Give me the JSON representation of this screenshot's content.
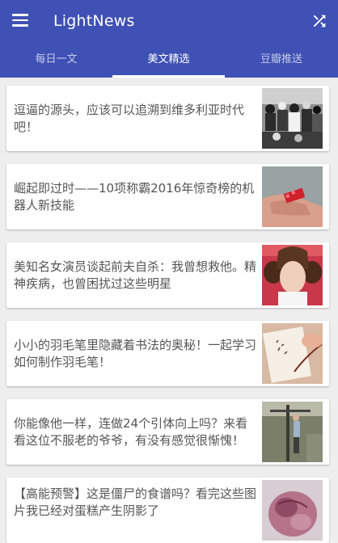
{
  "app": {
    "title": "LightNews"
  },
  "icons": {
    "menu": "menu-icon",
    "shuffle": "shuffle-icon"
  },
  "colors": {
    "primary": "#3f51b5",
    "tab_active": "#ffffff",
    "tab_inactive": "#c5cae9",
    "background": "#eeeeee"
  },
  "tabs": [
    {
      "label": "每日一文"
    },
    {
      "label": "美文精选",
      "active": true
    },
    {
      "label": "豆瓣推送"
    }
  ],
  "articles": [
    {
      "title": "逗逼的源头，应该可以追溯到维多利亚时代吧！"
    },
    {
      "title": "崛起即过时——10项称霸2016年惊奇榜的机器人新技能"
    },
    {
      "title": "美知名女演员谈起前夫自杀：我曾想救他。精神疾病，也曾困扰过这些明星"
    },
    {
      "title": "小小的羽毛笔里隐藏着书法的奥秘！一起学习如何制作羽毛笔！"
    },
    {
      "title": "你能像他一样，连做24个引体向上吗？来看看这位不服老的爷爷，有没有感觉很惭愧！"
    },
    {
      "title": "【高能预警】这是僵尸的食谱吗？看完这些图片我已经对蛋糕产生阴影了"
    }
  ]
}
